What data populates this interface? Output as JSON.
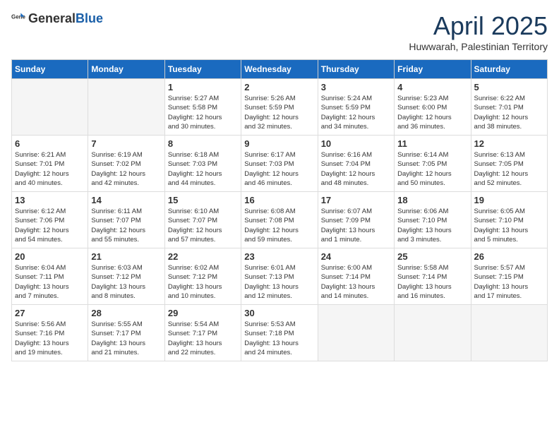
{
  "header": {
    "logo_general": "General",
    "logo_blue": "Blue",
    "month_title": "April 2025",
    "location": "Huwwarah, Palestinian Territory"
  },
  "weekdays": [
    "Sunday",
    "Monday",
    "Tuesday",
    "Wednesday",
    "Thursday",
    "Friday",
    "Saturday"
  ],
  "weeks": [
    [
      {
        "day": "",
        "info": ""
      },
      {
        "day": "",
        "info": ""
      },
      {
        "day": "1",
        "info": "Sunrise: 5:27 AM\nSunset: 5:58 PM\nDaylight: 12 hours\nand 30 minutes."
      },
      {
        "day": "2",
        "info": "Sunrise: 5:26 AM\nSunset: 5:59 PM\nDaylight: 12 hours\nand 32 minutes."
      },
      {
        "day": "3",
        "info": "Sunrise: 5:24 AM\nSunset: 5:59 PM\nDaylight: 12 hours\nand 34 minutes."
      },
      {
        "day": "4",
        "info": "Sunrise: 5:23 AM\nSunset: 6:00 PM\nDaylight: 12 hours\nand 36 minutes."
      },
      {
        "day": "5",
        "info": "Sunrise: 6:22 AM\nSunset: 7:01 PM\nDaylight: 12 hours\nand 38 minutes."
      }
    ],
    [
      {
        "day": "6",
        "info": "Sunrise: 6:21 AM\nSunset: 7:01 PM\nDaylight: 12 hours\nand 40 minutes."
      },
      {
        "day": "7",
        "info": "Sunrise: 6:19 AM\nSunset: 7:02 PM\nDaylight: 12 hours\nand 42 minutes."
      },
      {
        "day": "8",
        "info": "Sunrise: 6:18 AM\nSunset: 7:03 PM\nDaylight: 12 hours\nand 44 minutes."
      },
      {
        "day": "9",
        "info": "Sunrise: 6:17 AM\nSunset: 7:03 PM\nDaylight: 12 hours\nand 46 minutes."
      },
      {
        "day": "10",
        "info": "Sunrise: 6:16 AM\nSunset: 7:04 PM\nDaylight: 12 hours\nand 48 minutes."
      },
      {
        "day": "11",
        "info": "Sunrise: 6:14 AM\nSunset: 7:05 PM\nDaylight: 12 hours\nand 50 minutes."
      },
      {
        "day": "12",
        "info": "Sunrise: 6:13 AM\nSunset: 7:05 PM\nDaylight: 12 hours\nand 52 minutes."
      }
    ],
    [
      {
        "day": "13",
        "info": "Sunrise: 6:12 AM\nSunset: 7:06 PM\nDaylight: 12 hours\nand 54 minutes."
      },
      {
        "day": "14",
        "info": "Sunrise: 6:11 AM\nSunset: 7:07 PM\nDaylight: 12 hours\nand 55 minutes."
      },
      {
        "day": "15",
        "info": "Sunrise: 6:10 AM\nSunset: 7:07 PM\nDaylight: 12 hours\nand 57 minutes."
      },
      {
        "day": "16",
        "info": "Sunrise: 6:08 AM\nSunset: 7:08 PM\nDaylight: 12 hours\nand 59 minutes."
      },
      {
        "day": "17",
        "info": "Sunrise: 6:07 AM\nSunset: 7:09 PM\nDaylight: 13 hours\nand 1 minute."
      },
      {
        "day": "18",
        "info": "Sunrise: 6:06 AM\nSunset: 7:10 PM\nDaylight: 13 hours\nand 3 minutes."
      },
      {
        "day": "19",
        "info": "Sunrise: 6:05 AM\nSunset: 7:10 PM\nDaylight: 13 hours\nand 5 minutes."
      }
    ],
    [
      {
        "day": "20",
        "info": "Sunrise: 6:04 AM\nSunset: 7:11 PM\nDaylight: 13 hours\nand 7 minutes."
      },
      {
        "day": "21",
        "info": "Sunrise: 6:03 AM\nSunset: 7:12 PM\nDaylight: 13 hours\nand 8 minutes."
      },
      {
        "day": "22",
        "info": "Sunrise: 6:02 AM\nSunset: 7:12 PM\nDaylight: 13 hours\nand 10 minutes."
      },
      {
        "day": "23",
        "info": "Sunrise: 6:01 AM\nSunset: 7:13 PM\nDaylight: 13 hours\nand 12 minutes."
      },
      {
        "day": "24",
        "info": "Sunrise: 6:00 AM\nSunset: 7:14 PM\nDaylight: 13 hours\nand 14 minutes."
      },
      {
        "day": "25",
        "info": "Sunrise: 5:58 AM\nSunset: 7:14 PM\nDaylight: 13 hours\nand 16 minutes."
      },
      {
        "day": "26",
        "info": "Sunrise: 5:57 AM\nSunset: 7:15 PM\nDaylight: 13 hours\nand 17 minutes."
      }
    ],
    [
      {
        "day": "27",
        "info": "Sunrise: 5:56 AM\nSunset: 7:16 PM\nDaylight: 13 hours\nand 19 minutes."
      },
      {
        "day": "28",
        "info": "Sunrise: 5:55 AM\nSunset: 7:17 PM\nDaylight: 13 hours\nand 21 minutes."
      },
      {
        "day": "29",
        "info": "Sunrise: 5:54 AM\nSunset: 7:17 PM\nDaylight: 13 hours\nand 22 minutes."
      },
      {
        "day": "30",
        "info": "Sunrise: 5:53 AM\nSunset: 7:18 PM\nDaylight: 13 hours\nand 24 minutes."
      },
      {
        "day": "",
        "info": ""
      },
      {
        "day": "",
        "info": ""
      },
      {
        "day": "",
        "info": ""
      }
    ]
  ]
}
